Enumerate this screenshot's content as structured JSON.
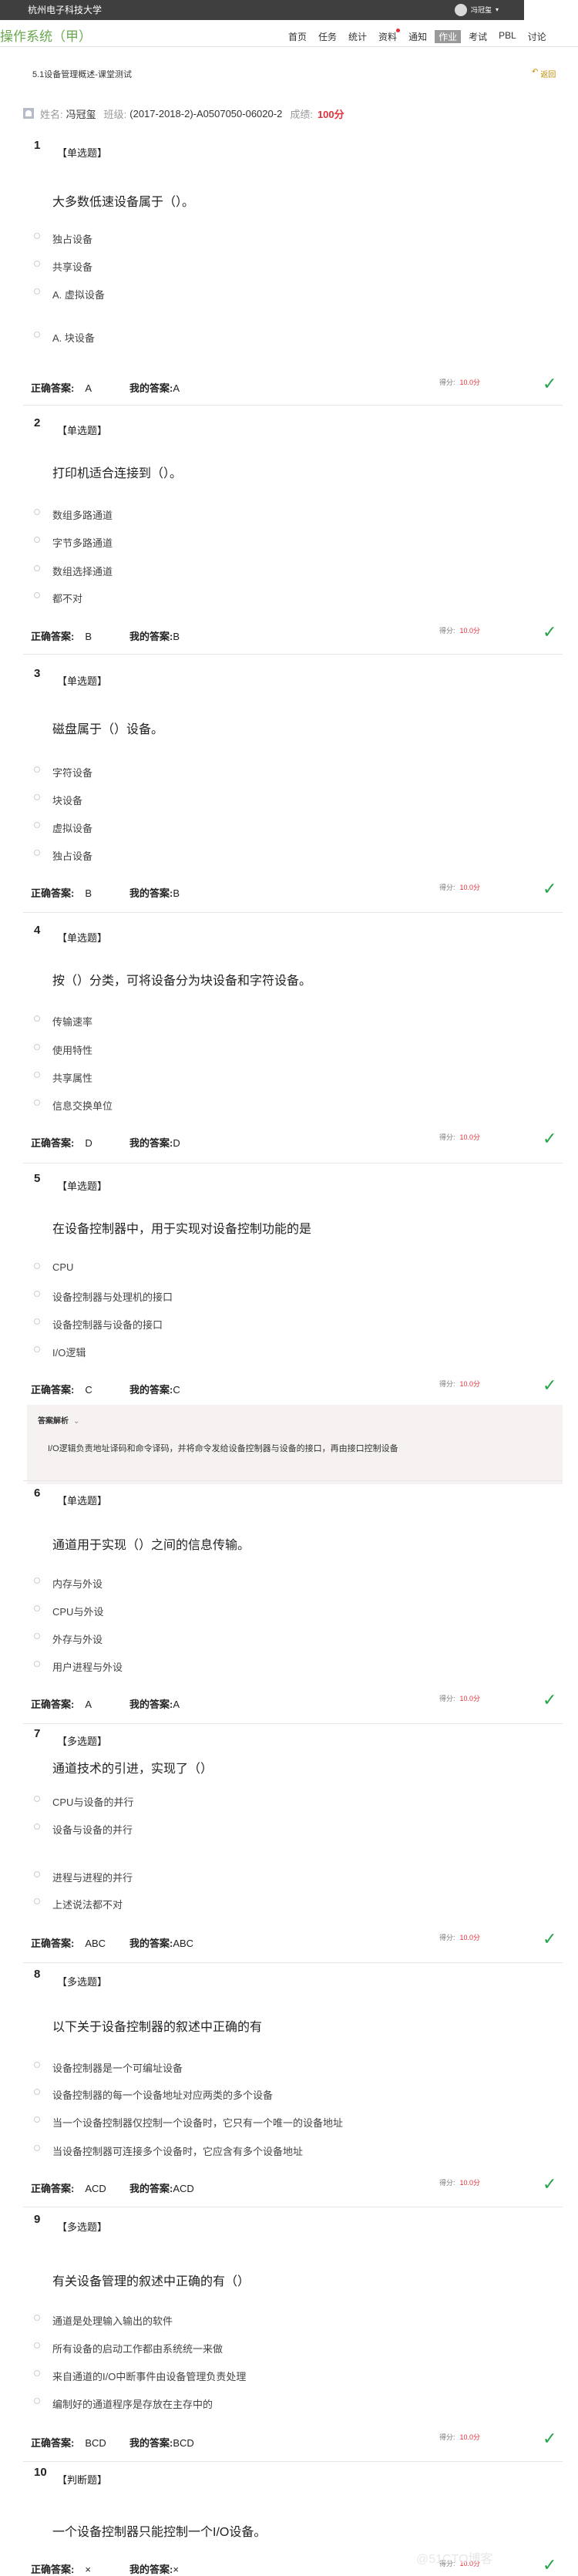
{
  "header": {
    "school": "杭州电子科技大学",
    "user": "冯冠玺"
  },
  "navbar": {
    "title": "操作系统（甲）",
    "items": [
      "首页",
      "任务",
      "统计",
      "资料",
      "通知",
      "作业",
      "考试",
      "PBL",
      "讨论"
    ],
    "active": "作业",
    "dot_on": "资料"
  },
  "page": {
    "breadcrumb": "5.1设备管理概述-课堂测试",
    "back_label": "返回"
  },
  "student": {
    "name_label": "姓名:",
    "name": "冯冠玺",
    "class_label": "班级:",
    "class": "(2017-2018-2)-A0507050-06020-2",
    "score_label": "成绩:",
    "score": "100分"
  },
  "labels": {
    "correct": "正确答案:",
    "mine": "我的答案:",
    "points": "得分:",
    "analysis": "答案解析"
  },
  "questions": [
    {
      "num": "1",
      "type": "【单选题】",
      "text": "大多数低速设备属于（）。",
      "options": [
        "独占设备",
        "共享设备",
        "A. 虚拟设备",
        "A. 块设备"
      ],
      "correct": "A",
      "mine": "A",
      "points": "10.0分"
    },
    {
      "num": "2",
      "type": "【单选题】",
      "text": "打印机适合连接到（）。",
      "options": [
        "数组多路通道",
        "字节多路通道",
        "数组选择通道",
        "都不对"
      ],
      "correct": "B",
      "mine": "B",
      "points": "10.0分"
    },
    {
      "num": "3",
      "type": "【单选题】",
      "text": "磁盘属于（）设备。",
      "options": [
        "字符设备",
        "块设备",
        "虚拟设备",
        "独占设备"
      ],
      "correct": "B",
      "mine": "B",
      "points": "10.0分"
    },
    {
      "num": "4",
      "type": "【单选题】",
      "text": "按（）分类，可将设备分为块设备和字符设备。",
      "options": [
        "传输速率",
        "使用特性",
        "共享属性",
        "信息交换单位"
      ],
      "correct": "D",
      "mine": "D",
      "points": "10.0分"
    },
    {
      "num": "5",
      "type": "【单选题】",
      "text": "在设备控制器中，用于实现对设备控制功能的是",
      "options": [
        "CPU",
        "设备控制器与处理机的接口",
        "设备控制器与设备的接口",
        "I/O逻辑"
      ],
      "correct": "C",
      "mine": "C",
      "points": "10.0分",
      "analysis": "I/O逻辑负责地址译码和命令译码，并将命令发给设备控制器与设备的接口，再由接口控制设备"
    },
    {
      "num": "6",
      "type": "【单选题】",
      "text": "通道用于实现（）之间的信息传输。",
      "options": [
        "内存与外设",
        "CPU与外设",
        "外存与外设",
        "用户进程与外设"
      ],
      "correct": "A",
      "mine": "A",
      "points": "10.0分"
    },
    {
      "num": "7",
      "type": "【多选题】",
      "text": "通道技术的引进，实现了（）",
      "options": [
        "CPU与设备的并行",
        "设备与设备的并行",
        "进程与进程的并行",
        "上述说法都不对"
      ],
      "correct": "ABC",
      "mine": "ABC",
      "points": "10.0分"
    },
    {
      "num": "8",
      "type": "【多选题】",
      "text": "以下关于设备控制器的叙述中正确的有",
      "options": [
        "设备控制器是一个可编址设备",
        "设备控制器的每一个设备地址对应两类的多个设备",
        "当一个设备控制器仅控制一个设备时，它只有一个唯一的设备地址",
        "当设备控制器可连接多个设备时，它应含有多个设备地址"
      ],
      "correct": "ACD",
      "mine": "ACD",
      "points": "10.0分"
    },
    {
      "num": "9",
      "type": "【多选题】",
      "text": "有关设备管理的叙述中正确的有（）",
      "options": [
        "通道是处理输入输出的软件",
        "所有设备的启动工作都由系统统一来做",
        "来自通道的I/O中断事件由设备管理负责处理",
        "编制好的通道程序是存放在主存中的"
      ],
      "correct": "BCD",
      "mine": "BCD",
      "points": "10.0分"
    },
    {
      "num": "10",
      "type": "【判断题】",
      "text": "一个设备控制器只能控制一个I/O设备。",
      "options": [],
      "correct": "×",
      "mine": "×",
      "points": "10.0分"
    }
  ],
  "watermark": "@51CTO博客"
}
